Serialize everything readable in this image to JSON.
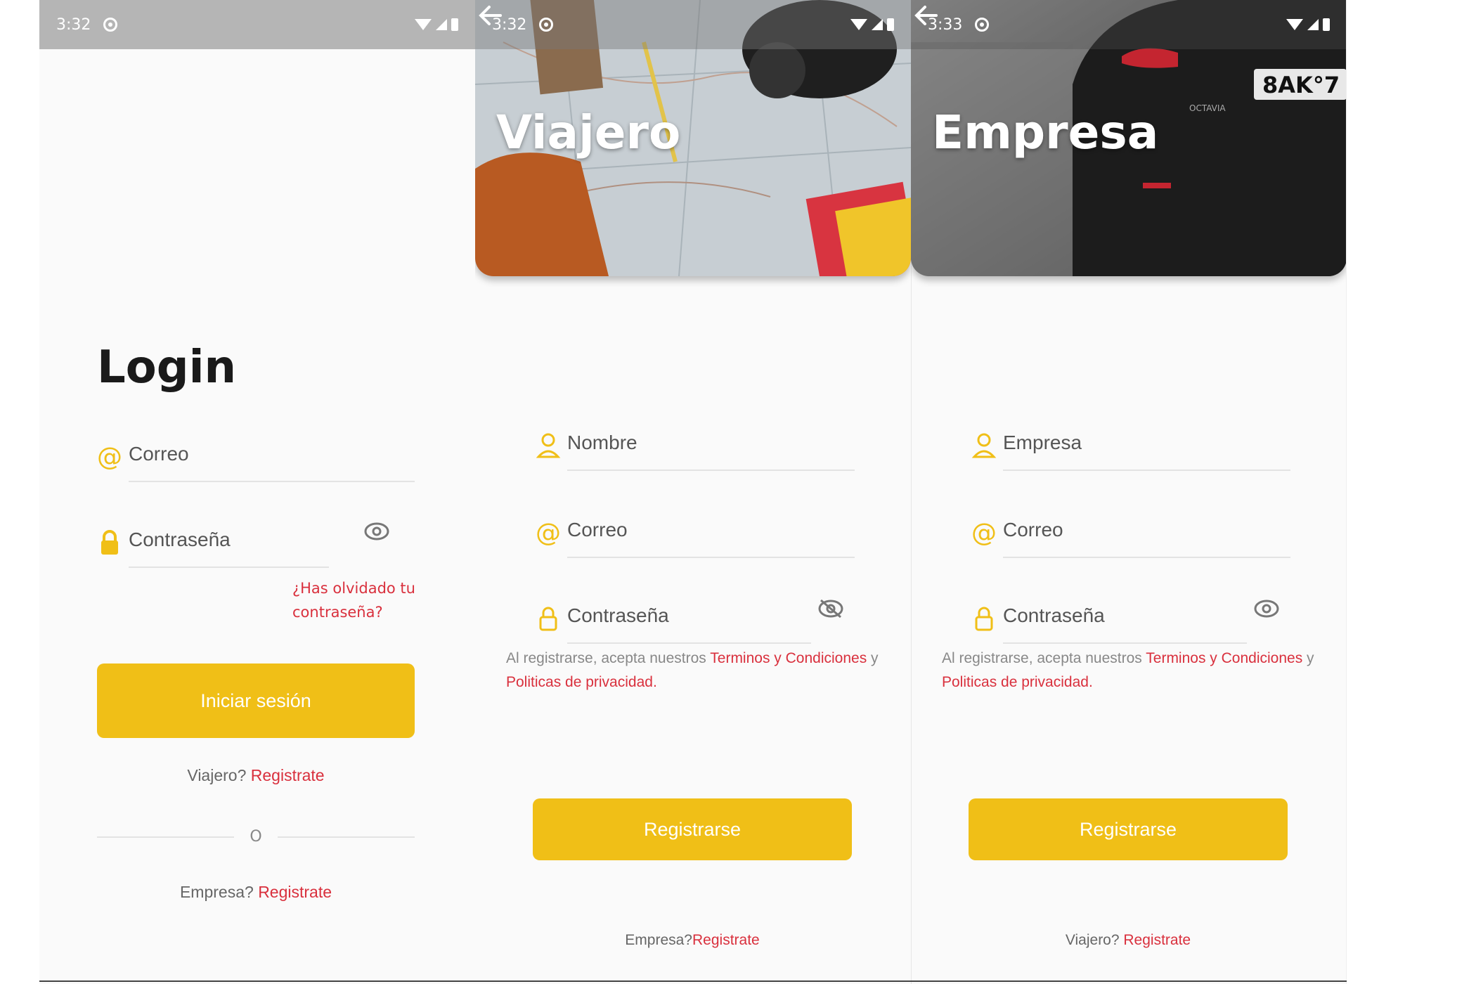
{
  "login": {
    "status": {
      "time": "3:32"
    },
    "title": "Login",
    "email_placeholder": "Correo",
    "password_placeholder": "Contraseña",
    "forgot": "¿Has olvidado tu contraseña?",
    "login_button": "Iniciar sesión",
    "traveler_prompt": "Viajero?",
    "traveler_link": "Registrate",
    "or": "O",
    "company_prompt": "Empresa?",
    "company_link": "Registrate"
  },
  "viajero": {
    "status": {
      "time": "3:32"
    },
    "title": "Viajero",
    "name_placeholder": "Nombre",
    "email_placeholder": "Correo",
    "password_placeholder": "Contraseña",
    "terms_prefix": "Al registrarse, acepta nuestros ",
    "terms_link": "Terminos y Condiciones",
    "terms_and": " y ",
    "privacy_link": "Politicas de privacidad.",
    "register_button": "Registrarse",
    "alt_prompt": "Empresa?",
    "alt_link": "Registrate"
  },
  "empresa": {
    "status": {
      "time": "3:33"
    },
    "title": "Empresa",
    "company_placeholder": "Empresa",
    "email_placeholder": "Correo",
    "password_placeholder": "Contraseña",
    "terms_prefix": "Al registrarse, acepta nuestros ",
    "terms_link": "Terminos y Condiciones",
    "terms_and": " y ",
    "privacy_link": "Politicas de privacidad.",
    "register_button": "Registrarse",
    "alt_prompt": "Viajero?",
    "alt_link": "Registrate"
  },
  "colors": {
    "accent": "#f0bf17",
    "link": "#d9303d",
    "background": "#fafafa"
  }
}
